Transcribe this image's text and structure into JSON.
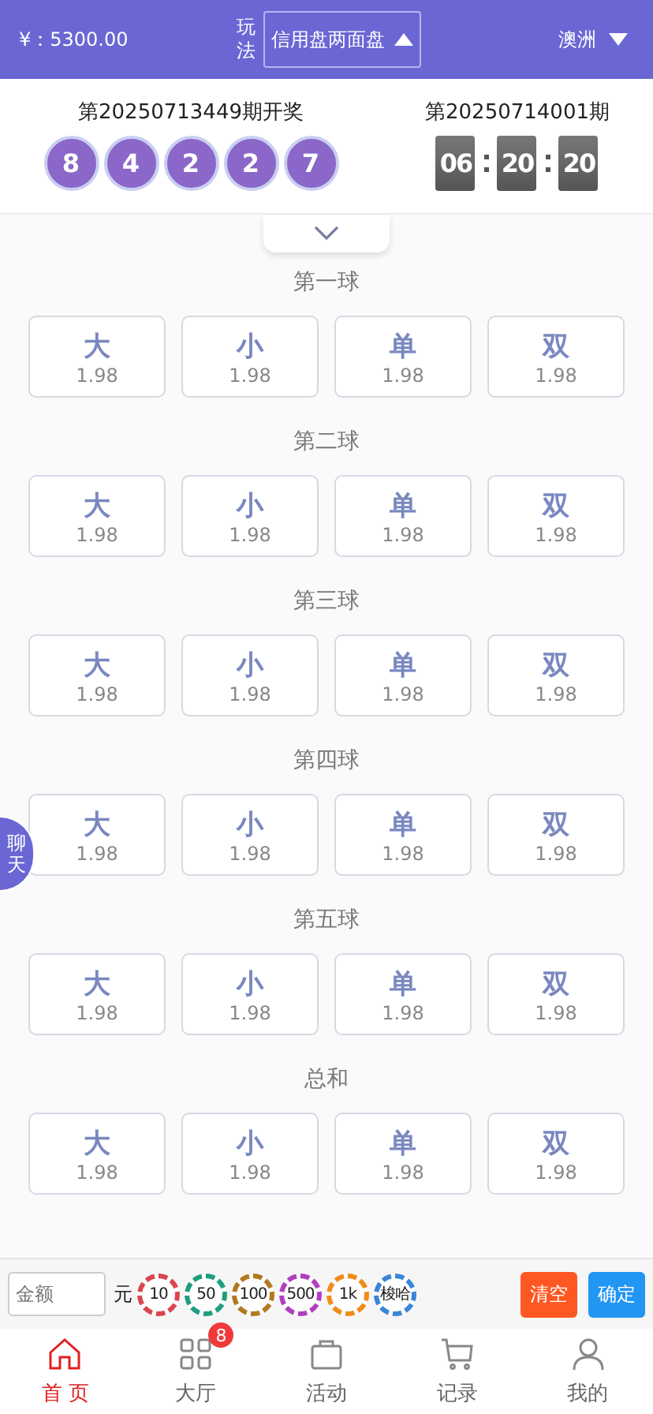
{
  "header": {
    "balance": "¥：5300.00",
    "play_label": "玩法",
    "play_mode": "信用盘两面盘",
    "region": "澳洲"
  },
  "draw": {
    "last_issue": "第20250713449期开奖",
    "balls": [
      "8",
      "4",
      "2",
      "2",
      "7"
    ],
    "next_issue": "第20250714001期",
    "countdown": [
      "06",
      "20",
      "20"
    ]
  },
  "sections": [
    {
      "title": "第一球",
      "options": [
        {
          "label": "大",
          "odds": "1.98"
        },
        {
          "label": "小",
          "odds": "1.98"
        },
        {
          "label": "单",
          "odds": "1.98"
        },
        {
          "label": "双",
          "odds": "1.98"
        }
      ]
    },
    {
      "title": "第二球",
      "options": [
        {
          "label": "大",
          "odds": "1.98"
        },
        {
          "label": "小",
          "odds": "1.98"
        },
        {
          "label": "单",
          "odds": "1.98"
        },
        {
          "label": "双",
          "odds": "1.98"
        }
      ]
    },
    {
      "title": "第三球",
      "options": [
        {
          "label": "大",
          "odds": "1.98"
        },
        {
          "label": "小",
          "odds": "1.98"
        },
        {
          "label": "单",
          "odds": "1.98"
        },
        {
          "label": "双",
          "odds": "1.98"
        }
      ]
    },
    {
      "title": "第四球",
      "options": [
        {
          "label": "大",
          "odds": "1.98"
        },
        {
          "label": "小",
          "odds": "1.98"
        },
        {
          "label": "单",
          "odds": "1.98"
        },
        {
          "label": "双",
          "odds": "1.98"
        }
      ]
    },
    {
      "title": "第五球",
      "options": [
        {
          "label": "大",
          "odds": "1.98"
        },
        {
          "label": "小",
          "odds": "1.98"
        },
        {
          "label": "单",
          "odds": "1.98"
        },
        {
          "label": "双",
          "odds": "1.98"
        }
      ]
    },
    {
      "title": "总和",
      "options": [
        {
          "label": "大",
          "odds": "1.98"
        },
        {
          "label": "小",
          "odds": "1.98"
        },
        {
          "label": "单",
          "odds": "1.98"
        },
        {
          "label": "双",
          "odds": "1.98"
        }
      ]
    }
  ],
  "chat_tab": "聊天",
  "bet_bar": {
    "amount_placeholder": "金额",
    "unit": "元",
    "chips": [
      {
        "label": "10",
        "color": "#d9464e"
      },
      {
        "label": "50",
        "color": "#1f9e7e"
      },
      {
        "label": "100",
        "color": "#b07a1e"
      },
      {
        "label": "500",
        "color": "#b03fc0"
      },
      {
        "label": "1k",
        "color": "#f08c1a"
      },
      {
        "label": "梭哈",
        "color": "#3a86d9"
      }
    ],
    "clear": "清空",
    "confirm": "确定"
  },
  "tab_bar": [
    {
      "label": "首 页",
      "kind": "home",
      "selected": true
    },
    {
      "label": "大厅",
      "kind": "grid",
      "selected": false,
      "badge": "8"
    },
    {
      "label": "活动",
      "kind": "bag",
      "selected": false
    },
    {
      "label": "记录",
      "kind": "cart",
      "selected": false
    },
    {
      "label": "我的",
      "kind": "user",
      "selected": false
    }
  ]
}
